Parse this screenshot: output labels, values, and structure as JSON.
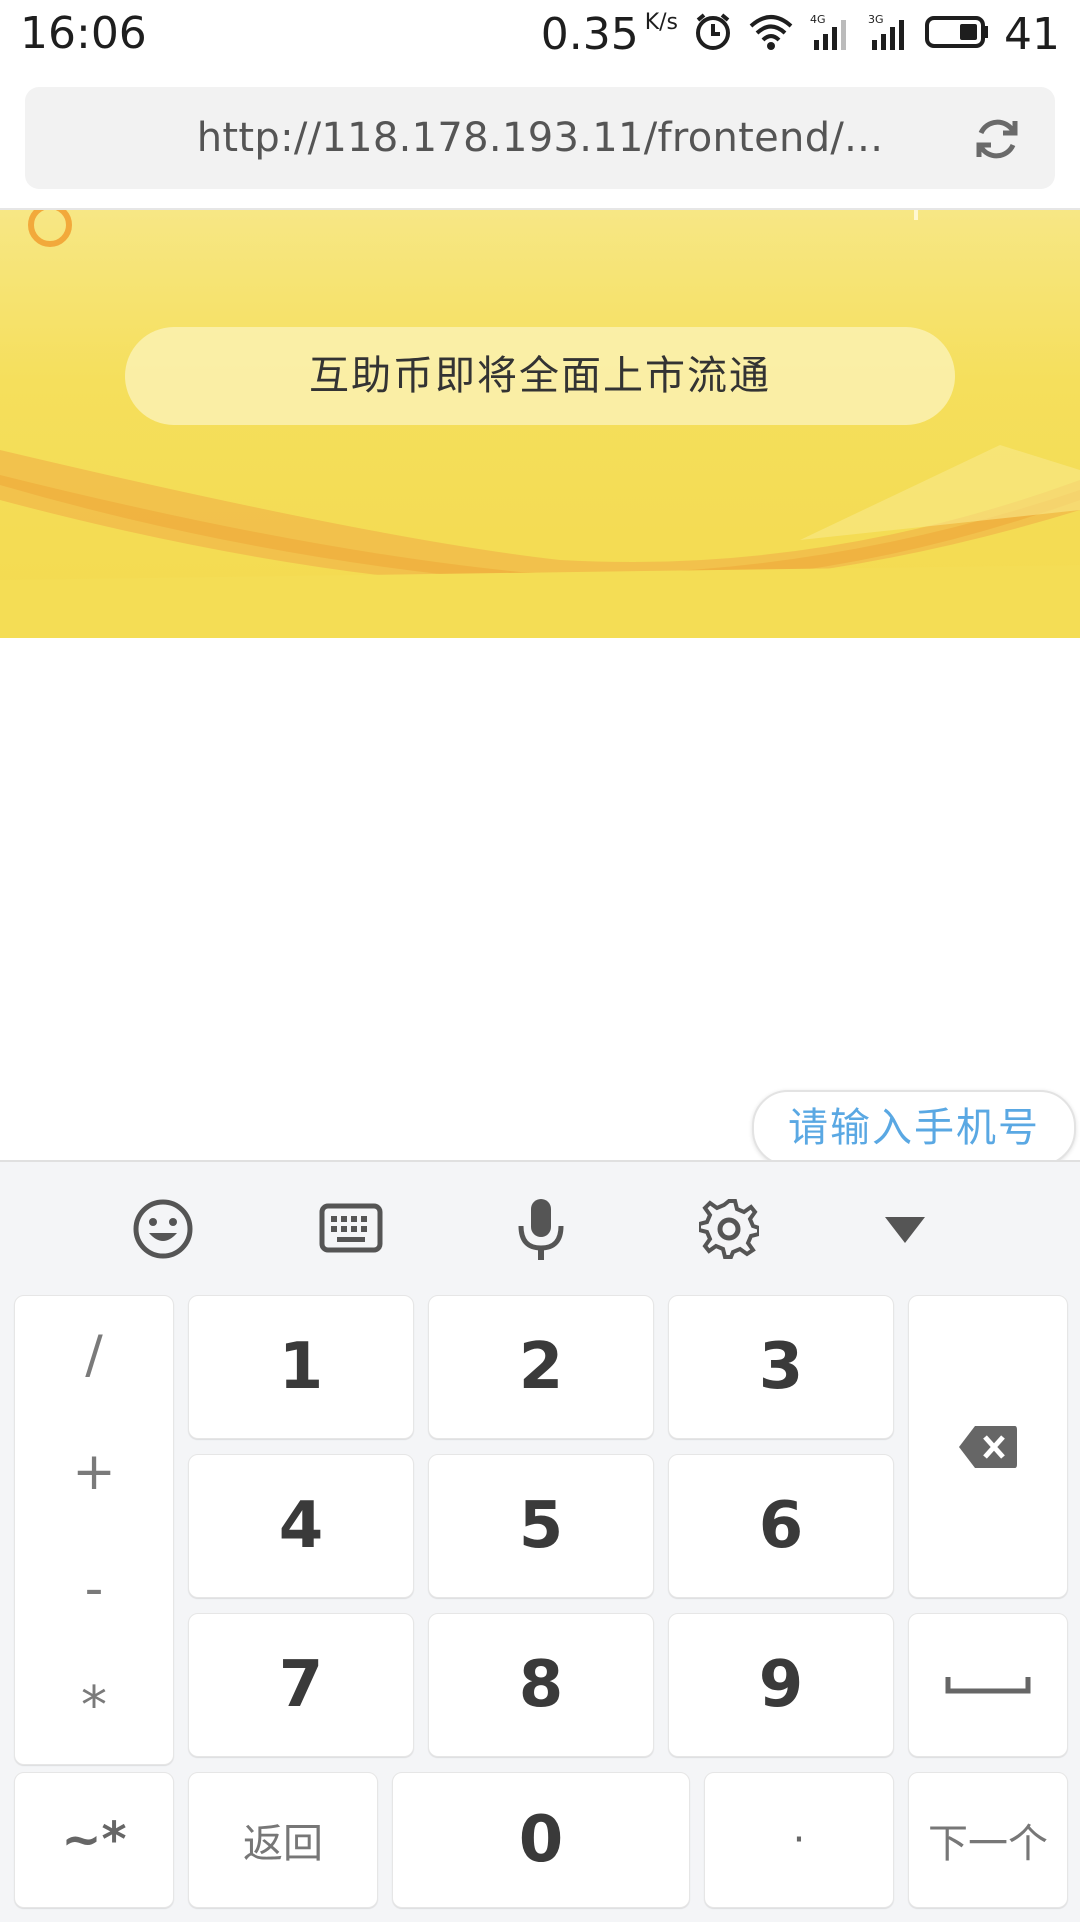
{
  "status_bar": {
    "time": "16:06",
    "speed": "0.35",
    "speed_unit": "K/s",
    "network_1": "4G",
    "network_2": "3G",
    "battery": "41"
  },
  "url_bar": {
    "url": "http://118.178.193.11/frontend/..."
  },
  "banner": {
    "pill_text": "互助币即将全面上市流通"
  },
  "phone_hint": "请输入手机号",
  "keyboard": {
    "toolbar": [
      "emoji-icon",
      "keyboard-icon",
      "microphone-icon",
      "gear-icon",
      "collapse-icon"
    ],
    "symbols": [
      "/",
      "+",
      "-",
      "*"
    ],
    "row1": [
      "1",
      "2",
      "3"
    ],
    "row2": [
      "4",
      "5",
      "6"
    ],
    "row3": [
      "7",
      "8",
      "9"
    ],
    "bottom": {
      "symbols_key": "~*",
      "back": "返回",
      "zero": "0",
      "dot": "·",
      "next": "下一个"
    }
  },
  "colors": {
    "banner_yellow": "#f3da4f",
    "hint_blue": "#5aa8e3"
  }
}
